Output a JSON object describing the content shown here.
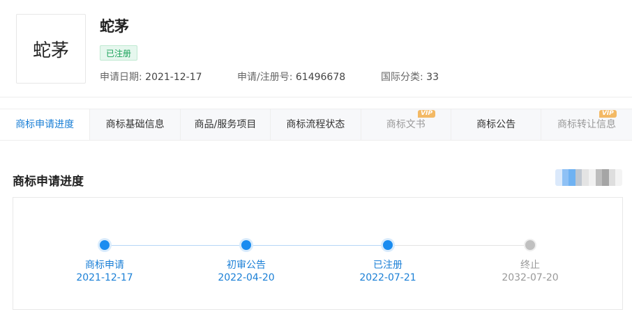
{
  "trademark": {
    "logo_text": "蛇茅",
    "name": "蛇茅",
    "status": "已注册",
    "apply_date_label": "申请日期:",
    "apply_date": "2021-12-17",
    "reg_no_label": "申请/注册号:",
    "reg_no": "61496678",
    "intl_class_label": "国际分类:",
    "intl_class": "33"
  },
  "tabs": [
    {
      "label": "商标申请进度",
      "active": true,
      "vip": false
    },
    {
      "label": "商标基础信息",
      "active": false,
      "vip": false
    },
    {
      "label": "商品/服务项目",
      "active": false,
      "vip": false
    },
    {
      "label": "商标流程状态",
      "active": false,
      "vip": false
    },
    {
      "label": "商标文书",
      "active": false,
      "vip": true
    },
    {
      "label": "商标公告",
      "active": false,
      "vip": false
    },
    {
      "label": "商标转让信息",
      "active": false,
      "vip": true
    }
  ],
  "vip_badge": "VIP",
  "section": {
    "title": "商标申请进度"
  },
  "progress": {
    "steps": [
      {
        "label": "商标申请",
        "date": "2021-12-17",
        "done": true
      },
      {
        "label": "初审公告",
        "date": "2022-04-20",
        "done": true
      },
      {
        "label": "已注册",
        "date": "2022-07-21",
        "done": true
      },
      {
        "label": "终止",
        "date": "2032-07-20",
        "done": false
      }
    ]
  },
  "colors": {
    "accent": "#1a7fd6",
    "node_done": "#1a8cf0",
    "node_todo": "#c0c0c0",
    "status_green": "#1aa35a",
    "vip_orange": "#f3b964"
  }
}
